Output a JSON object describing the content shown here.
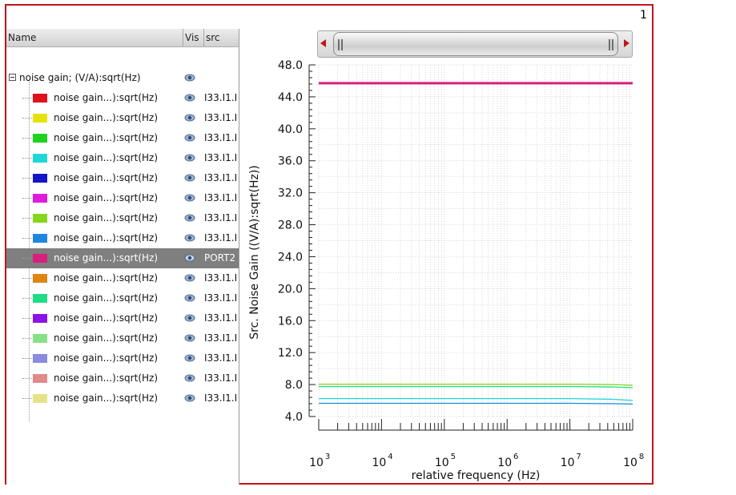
{
  "page_number": "1",
  "tree": {
    "columns": [
      "Name",
      "Vis",
      "src"
    ],
    "group_label": "noise gain; (V/A):sqrt(Hz)",
    "rows": [
      {
        "label": "noise gain...):sqrt(Hz)",
        "color": "#e0131c",
        "src": "I33.I1.I",
        "selected": false
      },
      {
        "label": "noise gain...):sqrt(Hz)",
        "color": "#e6e20e",
        "src": "I33.I1.I",
        "selected": false
      },
      {
        "label": "noise gain...):sqrt(Hz)",
        "color": "#1fd21f",
        "src": "I33.I1.I",
        "selected": false
      },
      {
        "label": "noise gain...):sqrt(Hz)",
        "color": "#1ed8d8",
        "src": "I33.I1.I",
        "selected": false
      },
      {
        "label": "noise gain...):sqrt(Hz)",
        "color": "#1515c8",
        "src": "I33.I1.I",
        "selected": false
      },
      {
        "label": "noise gain...):sqrt(Hz)",
        "color": "#e01be0",
        "src": "I33.I1.I",
        "selected": false
      },
      {
        "label": "noise gain...):sqrt(Hz)",
        "color": "#86d61c",
        "src": "I33.I1.I",
        "selected": false
      },
      {
        "label": "noise gain...):sqrt(Hz)",
        "color": "#1d86e0",
        "src": "I33.I1.I",
        "selected": false
      },
      {
        "label": "noise gain...):sqrt(Hz)",
        "color": "#d81f7e",
        "src": "PORT2",
        "selected": true
      },
      {
        "label": "noise gain...):sqrt(Hz)",
        "color": "#e08413",
        "src": "I33.I1.I",
        "selected": false
      },
      {
        "label": "noise gain...):sqrt(Hz)",
        "color": "#1fdc86",
        "src": "I33.I1.I",
        "selected": false
      },
      {
        "label": "noise gain...):sqrt(Hz)",
        "color": "#8a14e6",
        "src": "I33.I1.I",
        "selected": false
      },
      {
        "label": "noise gain...):sqrt(Hz)",
        "color": "#86e086",
        "src": "I33.I1.I",
        "selected": false
      },
      {
        "label": "noise gain...):sqrt(Hz)",
        "color": "#8a8ae0",
        "src": "I33.I1.I",
        "selected": false
      },
      {
        "label": "noise gain...):sqrt(Hz)",
        "color": "#e08a8a",
        "src": "I33.I1.I",
        "selected": false
      },
      {
        "label": "noise gain...):sqrt(Hz)",
        "color": "#e6e28a",
        "src": "I33.I1.I",
        "selected": false
      }
    ]
  },
  "chart_data": {
    "type": "line",
    "xlabel": "relative frequency (Hz)",
    "ylabel": "Src. Noise Gain ((V/A):sqrt(Hz))",
    "x_scale": "log",
    "xlim": [
      1000,
      100000000
    ],
    "ylim": [
      4.0,
      48.0
    ],
    "y_ticks": [
      "4.0",
      "8.0",
      "12.0",
      "16.0",
      "20.0",
      "24.0",
      "28.0",
      "32.0",
      "36.0",
      "40.0",
      "44.0",
      "48.0"
    ],
    "x_ticks": [
      {
        "value": 1000,
        "base": "10",
        "exp": "3"
      },
      {
        "value": 10000,
        "base": "10",
        "exp": "4"
      },
      {
        "value": 100000,
        "base": "10",
        "exp": "5"
      },
      {
        "value": 1000000,
        "base": "10",
        "exp": "6"
      },
      {
        "value": 10000000,
        "base": "10",
        "exp": "7"
      },
      {
        "value": 100000000,
        "base": "10",
        "exp": "8"
      }
    ],
    "grid": true,
    "series": [
      {
        "color": "#d81f7e",
        "x": [
          1000,
          100000000
        ],
        "y": [
          45.7,
          45.7
        ]
      },
      {
        "color": "#86d61c",
        "x": [
          1000,
          10000000,
          50000000,
          100000000
        ],
        "y": [
          8.05,
          8.05,
          8.0,
          7.9
        ]
      },
      {
        "color": "#1fdc86",
        "x": [
          1000,
          10000000,
          50000000,
          100000000
        ],
        "y": [
          7.75,
          7.75,
          7.7,
          7.6
        ]
      },
      {
        "color": "#1ed8d8",
        "x": [
          1000,
          10000000,
          50000000,
          100000000
        ],
        "y": [
          6.25,
          6.25,
          6.15,
          6.0
        ]
      },
      {
        "color": "#1d86e0",
        "x": [
          1000,
          10000000,
          50000000,
          100000000
        ],
        "y": [
          5.65,
          5.65,
          5.6,
          5.55
        ]
      }
    ]
  }
}
